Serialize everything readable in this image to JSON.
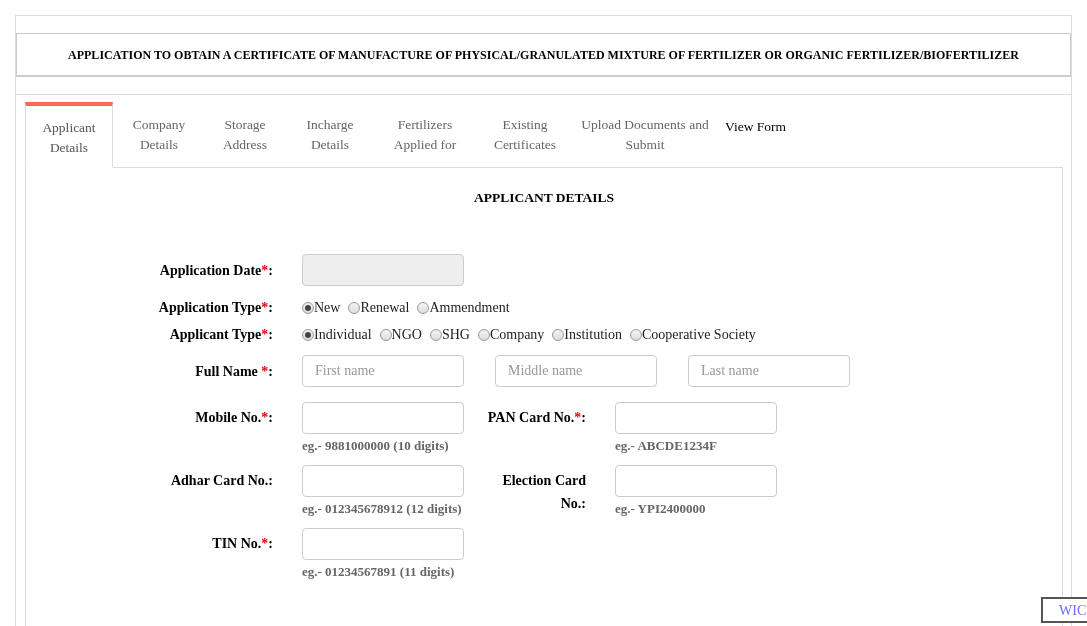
{
  "title": "APPLICATION TO OBTAIN A CERTIFICATE OF MANUFACTURE OF PHYSICAL/GRANULATED MIXTURE OF FERTILIZER OR ORGANIC FERTILIZER/BIOFERTILIZER",
  "tabs": [
    {
      "label": "Applicant Details",
      "selected": true,
      "kind": "tab"
    },
    {
      "label": "Company Details",
      "selected": false,
      "kind": "tab"
    },
    {
      "label": "Storage Address",
      "selected": false,
      "kind": "tab"
    },
    {
      "label": "Incharge Details",
      "selected": false,
      "kind": "tab"
    },
    {
      "label": "Fertilizers Applied for",
      "selected": false,
      "kind": "tab"
    },
    {
      "label": "Existing Certificates",
      "selected": false,
      "kind": "tab"
    },
    {
      "label": "Upload Documents and Submit",
      "selected": false,
      "kind": "tab"
    },
    {
      "label": "View Form",
      "selected": false,
      "kind": "link"
    }
  ],
  "section_title": "APPLICANT DETAILS",
  "rows": [
    {
      "kind": "date",
      "label": "Application Date",
      "required_mark": "*",
      "colon": ":",
      "disabled": true
    },
    {
      "kind": "radio",
      "label": "Application Type",
      "required_mark": "*",
      "colon": ":",
      "options": [
        {
          "label": "New",
          "selected": true
        },
        {
          "label": "Renewal",
          "selected": false
        },
        {
          "label": "Ammendment",
          "selected": false
        }
      ]
    },
    {
      "kind": "radio",
      "label": "Applicant Type",
      "required_mark": "*",
      "colon": ":",
      "options": [
        {
          "label": "Individual",
          "selected": true
        },
        {
          "label": "NGO",
          "selected": false
        },
        {
          "label": "SHG",
          "selected": false
        },
        {
          "label": "Company",
          "selected": false
        },
        {
          "label": "Institution",
          "selected": false
        },
        {
          "label": "Cooperative Society",
          "selected": false
        }
      ]
    },
    {
      "kind": "names",
      "label": "Full Name ",
      "required_mark": "*",
      "colon": ":",
      "inputs": [
        {
          "placeholder": "First name"
        },
        {
          "placeholder": "Middle name"
        },
        {
          "placeholder": "Last name"
        }
      ]
    },
    {
      "kind": "pair",
      "fields": [
        {
          "label": "Mobile No.",
          "required_mark": "*",
          "colon": ":",
          "hint": "eg.- 9881000000 (10 digits)"
        },
        {
          "label": "PAN Card No.",
          "required_mark": "*",
          "colon": ":",
          "hint": "eg.- ABCDE1234F"
        }
      ]
    },
    {
      "kind": "pair",
      "fields": [
        {
          "label": "Adhar Card No.",
          "colon": ":",
          "hint": "eg.- 012345678912 (12 digits)"
        },
        {
          "label": "Election Card No.",
          "colon": ":",
          "hint": "eg.- YPI2400000"
        }
      ]
    },
    {
      "kind": "pair",
      "fields": [
        {
          "label": "TIN No.",
          "required_mark": "*",
          "colon": ":",
          "hint": "eg.- 01234567891 (11 digits)"
        }
      ]
    }
  ],
  "floating_button": "WIC"
}
